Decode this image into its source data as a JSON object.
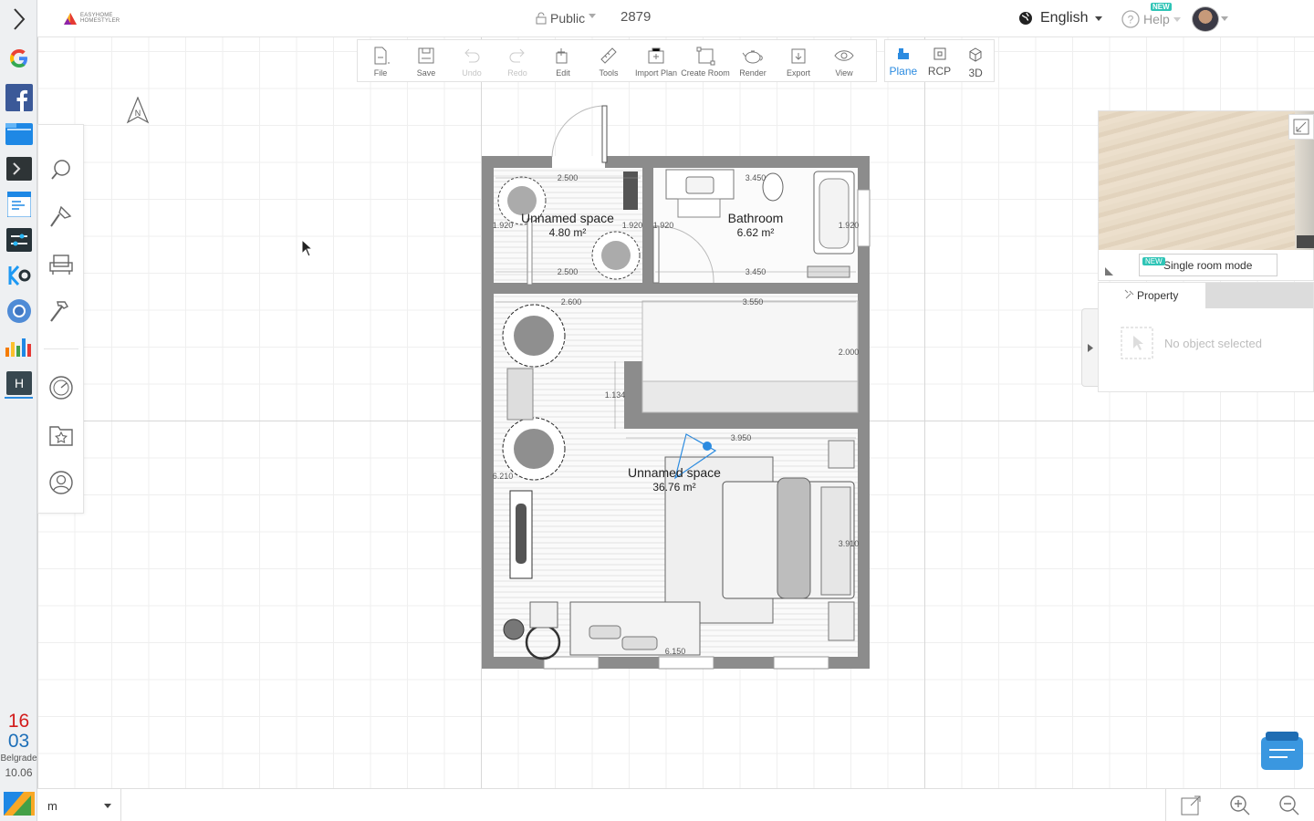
{
  "app": {
    "brand_line1": "EASYHOME",
    "brand_line2": "HOMESTYLER"
  },
  "header": {
    "visibility": "Public",
    "design_id": "2879",
    "language": "English",
    "help": "Help",
    "help_badge": "NEW"
  },
  "toolbar": {
    "items": [
      {
        "label": "File",
        "icon": "file-icon",
        "enabled": true
      },
      {
        "label": "Save",
        "icon": "save-icon",
        "enabled": true
      },
      {
        "label": "Undo",
        "icon": "undo-icon",
        "enabled": false
      },
      {
        "label": "Redo",
        "icon": "redo-icon",
        "enabled": false
      },
      {
        "label": "Edit",
        "icon": "edit-icon",
        "enabled": true
      },
      {
        "label": "Tools",
        "icon": "ruler-icon",
        "enabled": true
      },
      {
        "label": "Import Plan",
        "icon": "import-plan-icon",
        "enabled": true
      },
      {
        "label": "Create Room",
        "icon": "create-room-icon",
        "enabled": true
      },
      {
        "label": "Render",
        "icon": "teapot-icon",
        "enabled": true
      },
      {
        "label": "Export",
        "icon": "export-icon",
        "enabled": true
      },
      {
        "label": "View",
        "icon": "eye-icon",
        "enabled": true
      }
    ]
  },
  "view_modes": [
    {
      "label": "Plane",
      "active": true
    },
    {
      "label": "RCP",
      "active": false
    },
    {
      "label": "3D",
      "active": false
    }
  ],
  "compass": {
    "label": "N"
  },
  "floorplan": {
    "rooms": [
      {
        "name": "Unnamed space",
        "area": "4.80 m²"
      },
      {
        "name": "Bathroom",
        "area": "6.62 m²"
      },
      {
        "name": "Unnamed space",
        "area": "36.76 m²"
      }
    ],
    "dimensions": {
      "d1": "2.500",
      "d2": "1.920",
      "d3": "1.920",
      "d4": "2.500",
      "d5": "1.920",
      "d6": "3.450",
      "d7": "1.920",
      "d8": "3.450",
      "d9": "2.600",
      "d10": "3.550",
      "d11": "2.000",
      "d12": "1.134",
      "d13": "3.950",
      "d14": "6.210",
      "d15": "3.910",
      "d16": "6.150"
    }
  },
  "preview": {
    "single_room_badge": "NEW",
    "single_room_label": "Single room mode"
  },
  "property": {
    "tab_label": "Property",
    "empty_text": "No object selected"
  },
  "bottombar": {
    "unit": "m"
  },
  "os_clock": {
    "hour": "16",
    "minute": "03",
    "city": "Belgrade",
    "date": "10.06"
  },
  "colors": {
    "accent": "#2b8be0",
    "badge": "#2ec4b6",
    "wall": "#8c8c8c"
  }
}
